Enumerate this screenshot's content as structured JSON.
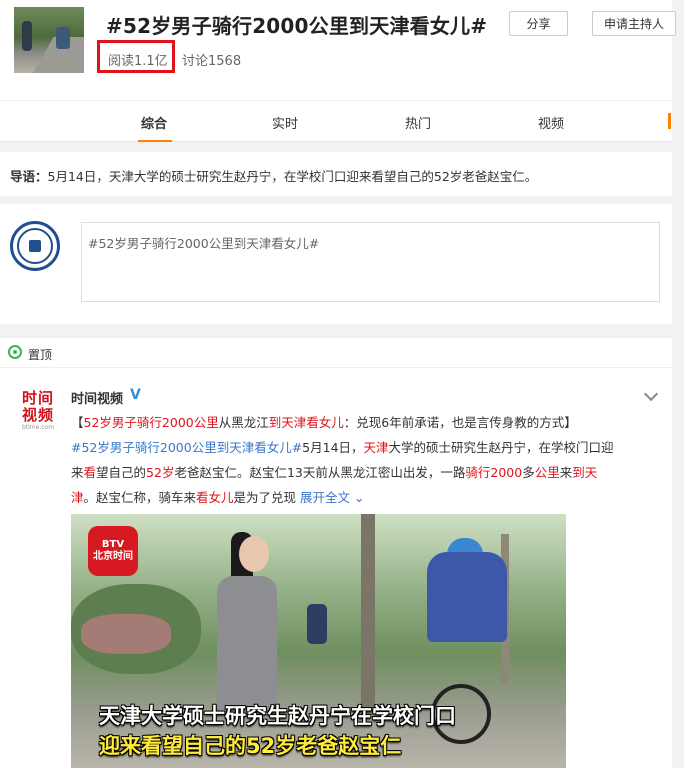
{
  "header": {
    "title": "#52岁男子骑行2000公里到天津看女儿#",
    "read_label": "阅读1.1亿",
    "discuss_label": "讨论1568",
    "share_label": "分享",
    "host_label": "申请主持人"
  },
  "tabs": [
    {
      "label": "综合",
      "active": true
    },
    {
      "label": "实时",
      "active": false
    },
    {
      "label": "热门",
      "active": false
    },
    {
      "label": "视频",
      "active": false
    }
  ],
  "lead": {
    "label": "导语：",
    "text": "5月14日，天津大学的硕士研究生赵丹宁，在学校门口迎来看望自己的52岁老爸赵宝仁。"
  },
  "composer": {
    "text": "#52岁男子骑行2000公里到天津看女儿#"
  },
  "pinned": {
    "label": "置顶"
  },
  "post": {
    "logo": {
      "line1": "时间",
      "line2": "视频",
      "line3": "btime.com"
    },
    "author": "时间视频",
    "verified": "V",
    "line1": {
      "a": "【",
      "b": "52岁男子骑行2000公里",
      "c": "从黑龙江",
      "d": "到天津看女儿",
      "e": "：兑现6年前承诺，也是言传身教的方式】"
    },
    "line2": {
      "tag": "#52岁男子骑行2000公里到天津看女儿#",
      "a": "5月14日，",
      "b": "天津",
      "c": "大学的硕士研究生赵丹宁，在学校门口迎"
    },
    "line3": {
      "a": "来",
      "b": "看",
      "c": "望自己的",
      "d": "52岁",
      "e": "老爸赵宝仁。赵宝仁13天前从黑龙江密山出发，一路",
      "f": "骑行2000",
      "g": "多",
      "h": "公里",
      "i": "来",
      "j": "到天"
    },
    "line4": {
      "a": "津",
      "b": "。赵宝仁称，骑车来",
      "c": "看女儿",
      "d": "是为了兑现 ",
      "expand": "展开全文",
      "expand_icon": "chevron-down-icon"
    },
    "video": {
      "badge": "BTV\n北京时间",
      "caption1": "天津大学硕士研究生赵丹宁在学校门口",
      "caption2": "迎来看望自己的52岁老爸赵宝仁"
    }
  },
  "colors": {
    "accent": "#ff8200",
    "highlight_red": "#e0131a",
    "link_blue": "#3b76c9",
    "tag_orange": "#eb7350",
    "pin_green": "#3ab54a",
    "verified_blue": "#2f8fe0",
    "caption_yellow": "#ffeb3b"
  }
}
